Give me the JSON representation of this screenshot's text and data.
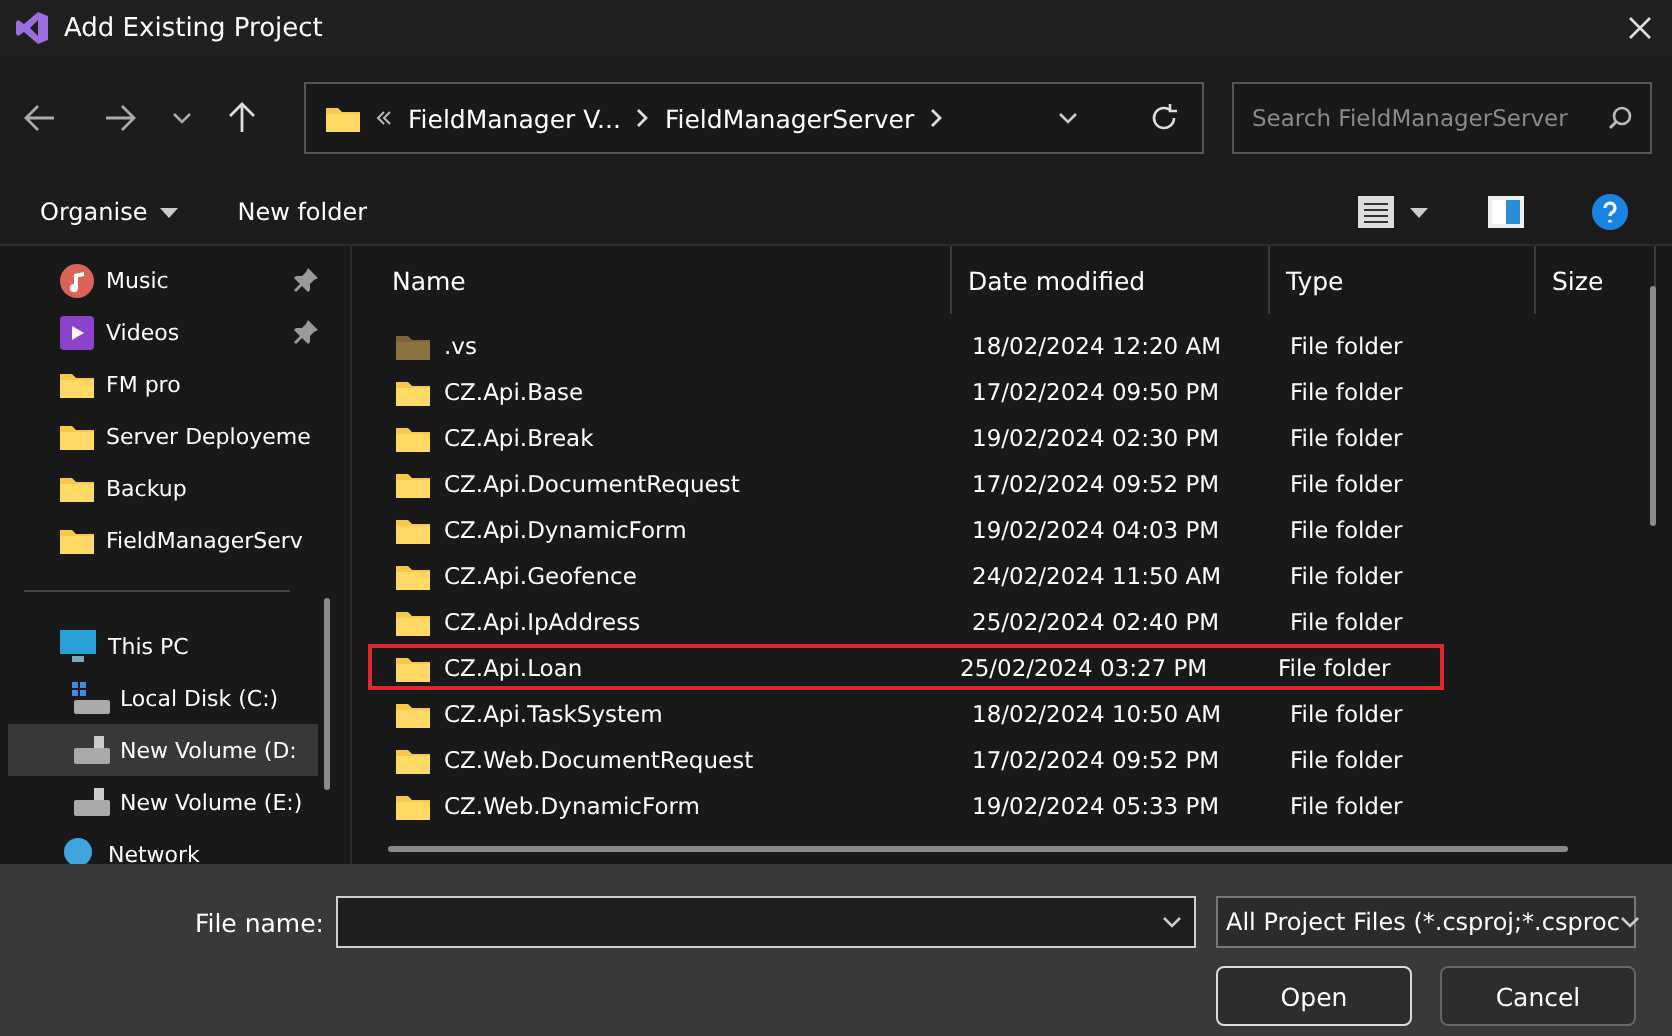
{
  "window": {
    "title": "Add Existing Project"
  },
  "address": {
    "crumbs": [
      "FieldManager V...",
      "FieldManagerServer"
    ]
  },
  "search": {
    "placeholder": "Search FieldManagerServer"
  },
  "toolbar": {
    "organise": "Organise",
    "new_folder": "New folder"
  },
  "sidebar": {
    "quick": [
      {
        "label": "Music",
        "kind": "music",
        "pinned": true,
        "selected": false
      },
      {
        "label": "Videos",
        "kind": "video",
        "pinned": true,
        "selected": false
      },
      {
        "label": "FM pro",
        "kind": "folder",
        "pinned": false,
        "selected": false
      },
      {
        "label": "Server Deployeme",
        "kind": "folder",
        "pinned": false,
        "selected": false
      },
      {
        "label": "Backup",
        "kind": "folder",
        "pinned": false,
        "selected": false
      },
      {
        "label": "FieldManagerServ",
        "kind": "folder",
        "pinned": false,
        "selected": false
      }
    ],
    "places": [
      {
        "label": "This PC",
        "kind": "pc",
        "selected": false,
        "children": [
          {
            "label": "Local Disk (C:)",
            "kind": "system-drive",
            "selected": false
          },
          {
            "label": "New Volume (D:",
            "kind": "drive",
            "selected": true
          },
          {
            "label": "New Volume (E:)",
            "kind": "drive",
            "selected": false
          }
        ]
      },
      {
        "label": "Network",
        "kind": "network",
        "selected": false
      }
    ]
  },
  "table": {
    "columns": [
      "Name",
      "Date modified",
      "Type",
      "Size"
    ],
    "rows": [
      {
        "name": ".vs",
        "date": "18/02/2024 12:20 AM",
        "type": "File folder",
        "hidden": true,
        "highlighted": false
      },
      {
        "name": "CZ.Api.Base",
        "date": "17/02/2024 09:50 PM",
        "type": "File folder",
        "hidden": false,
        "highlighted": false
      },
      {
        "name": "CZ.Api.Break",
        "date": "19/02/2024 02:30 PM",
        "type": "File folder",
        "hidden": false,
        "highlighted": false
      },
      {
        "name": "CZ.Api.DocumentRequest",
        "date": "17/02/2024 09:52 PM",
        "type": "File folder",
        "hidden": false,
        "highlighted": false
      },
      {
        "name": "CZ.Api.DynamicForm",
        "date": "19/02/2024 04:03 PM",
        "type": "File folder",
        "hidden": false,
        "highlighted": false
      },
      {
        "name": "CZ.Api.Geofence",
        "date": "24/02/2024 11:50 AM",
        "type": "File folder",
        "hidden": false,
        "highlighted": false
      },
      {
        "name": "CZ.Api.IpAddress",
        "date": "25/02/2024 02:40 PM",
        "type": "File folder",
        "hidden": false,
        "highlighted": false
      },
      {
        "name": "CZ.Api.Loan",
        "date": "25/02/2024 03:27 PM",
        "type": "File folder",
        "hidden": false,
        "highlighted": true
      },
      {
        "name": "CZ.Api.TaskSystem",
        "date": "18/02/2024 10:50 AM",
        "type": "File folder",
        "hidden": false,
        "highlighted": false
      },
      {
        "name": "CZ.Web.DocumentRequest",
        "date": "17/02/2024 09:52 PM",
        "type": "File folder",
        "hidden": false,
        "highlighted": false
      },
      {
        "name": "CZ.Web.DynamicForm",
        "date": "19/02/2024 05:33 PM",
        "type": "File folder",
        "hidden": false,
        "highlighted": false
      }
    ]
  },
  "footer": {
    "file_name_label": "File name:",
    "file_type": "All Project Files (*.csproj;*.csproc",
    "open": "Open",
    "cancel": "Cancel"
  }
}
